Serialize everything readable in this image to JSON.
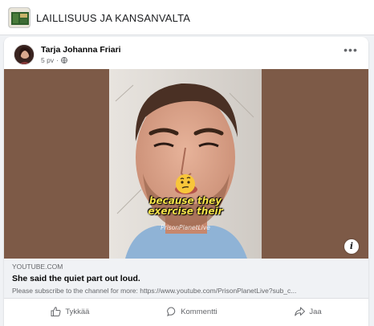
{
  "group": {
    "name": "LAILLISUUS JA KANSANVALTA",
    "thumb_icon": "group-cover-thumbnail"
  },
  "post": {
    "author": "Tarja Johanna Friari",
    "time": "5 pv",
    "separator": "·",
    "privacy_icon": "globe-icon",
    "more_label": "•••"
  },
  "media": {
    "caption_line1": "because they",
    "caption_line2": "exercise their",
    "watermark": "PrisonPlanetLive",
    "info_label": "i",
    "background_color": "#7d5a47",
    "caption_color": "#f6e34a"
  },
  "link": {
    "domain": "YOUTUBE.COM",
    "title": "She said the quiet part out loud.",
    "description": "Please subscribe to the channel for more: https://www.youtube.com/PrisonPlanetLive?sub_c..."
  },
  "actions": {
    "like_label": "Tykkää",
    "comment_label": "Kommentti",
    "share_label": "Jaa"
  }
}
